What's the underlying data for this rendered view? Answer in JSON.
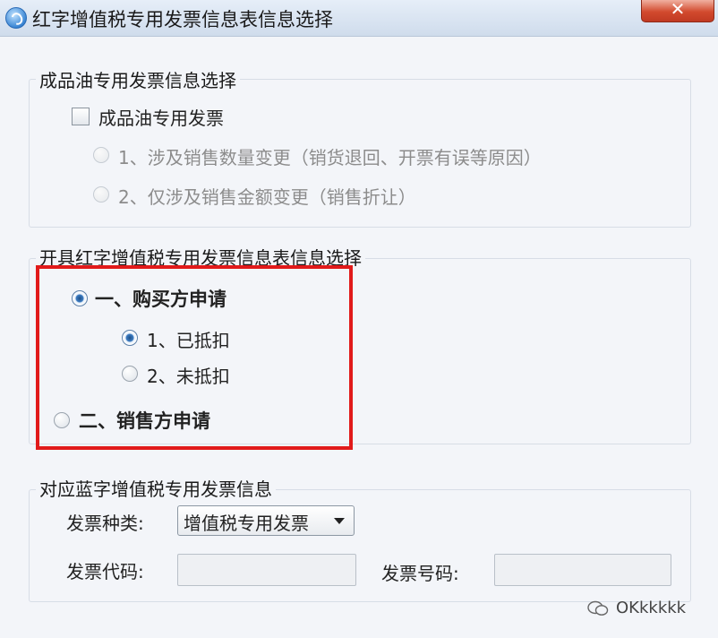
{
  "window": {
    "title": "红字增值税专用发票信息表信息选择",
    "close_label": "✕"
  },
  "oil_group": {
    "legend": "成品油专用发票信息选择",
    "checkbox_label": "成品油专用发票",
    "checkbox_checked": false,
    "options": [
      {
        "label": "1、涉及销售数量变更（销货退回、开票有误等原因）",
        "selected": false,
        "enabled": false
      },
      {
        "label": "2、仅涉及销售金额变更（销售折让）",
        "selected": false,
        "enabled": false
      }
    ]
  },
  "issue_group": {
    "legend": "开具红字增值税专用发票信息表信息选择",
    "buyer": {
      "label": "一、购买方申请",
      "selected": true,
      "sub_options": [
        {
          "label": "1、已抵扣",
          "selected": true
        },
        {
          "label": "2、未抵扣",
          "selected": false
        }
      ]
    },
    "seller": {
      "label": "二、销售方申请",
      "selected": false
    },
    "highlight_color": "#e11a1a"
  },
  "blue_invoice_group": {
    "legend": "对应蓝字增值税专用发票信息",
    "type_label": "发票种类:",
    "type_value": "增值税专用发票",
    "code_label": "发票代码:",
    "code_value": "",
    "number_label": "发票号码:",
    "number_value": ""
  },
  "watermark": {
    "text": "OKkkkkk"
  }
}
